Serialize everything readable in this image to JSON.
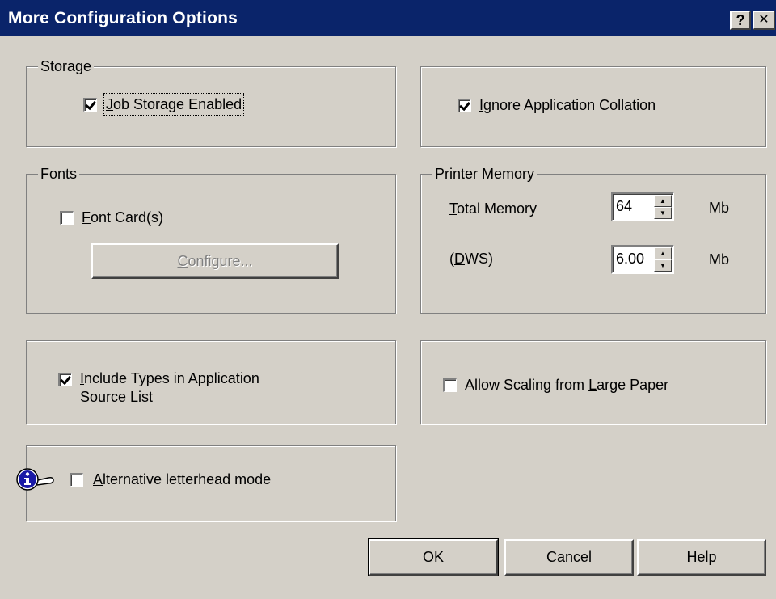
{
  "window": {
    "title": "More Configuration Options",
    "help_label": "?",
    "close_label": "✕"
  },
  "storage": {
    "legend": "Storage",
    "job_storage": {
      "label_key": "J",
      "label_rest": "ob Storage Enabled",
      "checked": true
    }
  },
  "collation": {
    "label_pre": "",
    "label_key": "I",
    "label_rest": "gnore Application Collation",
    "checked": true
  },
  "fonts": {
    "legend": "Fonts",
    "font_cards": {
      "label_key": "F",
      "label_rest": "ont Card(s)",
      "checked": false
    },
    "configure_key": "C",
    "configure_rest": "onfigure..."
  },
  "memory": {
    "legend": "Printer Memory",
    "total_key": "T",
    "total_rest": "otal Memory",
    "total_value": "64",
    "dws_open": "(",
    "dws_key": "D",
    "dws_rest": "WS)",
    "dws_value": "6.00",
    "unit": "Mb"
  },
  "types": {
    "label_key": "I",
    "label_rest": "nclude Types in Application",
    "label_line2": "Source List",
    "checked": true
  },
  "scaling": {
    "label_pre": "Allow Scaling from ",
    "label_key": "L",
    "label_rest": "arge Paper",
    "checked": false
  },
  "letterhead": {
    "label_key": "A",
    "label_rest": "lternative letterhead mode",
    "checked": false
  },
  "buttons": {
    "ok": "OK",
    "cancel": "Cancel",
    "help": "Help"
  },
  "icons": {
    "info": "info-pointer-icon"
  }
}
